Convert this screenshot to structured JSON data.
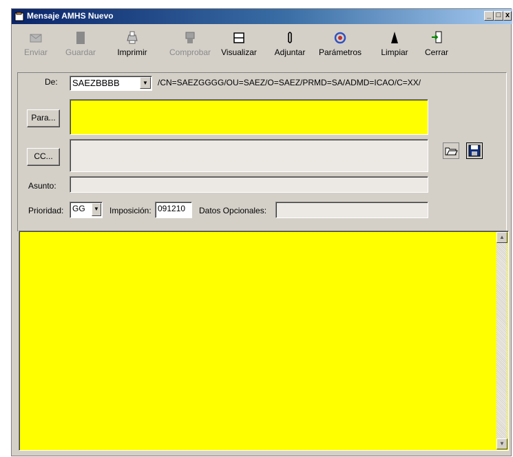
{
  "window": {
    "title": "Mensaje AMHS Nuevo",
    "controls": {
      "minimize": "_",
      "maximize": "□",
      "close": "x"
    }
  },
  "toolbar": {
    "buttons": [
      {
        "label": "Enviar",
        "icon": "send-icon",
        "enabled": false
      },
      {
        "label": "Guardar",
        "icon": "save-icon",
        "enabled": false
      },
      {
        "label": "Imprimir",
        "icon": "print-icon",
        "enabled": true
      },
      {
        "label": "Comprobar",
        "icon": "check-icon",
        "enabled": false
      },
      {
        "label": "Visualizar",
        "icon": "view-icon",
        "enabled": true
      },
      {
        "label": "Adjuntar",
        "icon": "paperclip-icon",
        "enabled": true
      },
      {
        "label": "Parámetros",
        "icon": "parameters-icon",
        "enabled": true
      },
      {
        "label": "Limpiar",
        "icon": "broom-icon",
        "enabled": true
      },
      {
        "label": "Cerrar",
        "icon": "exit-icon",
        "enabled": true
      }
    ]
  },
  "header": {
    "from_label": "De:",
    "from_value": "SAEZBBBB",
    "from_address": "/CN=SAEZGGGG/OU=SAEZ/O=SAEZ/PRMD=SA/ADMD=ICAO/C=XX/",
    "to_button": "Para...",
    "to_value": "",
    "cc_button": "CC...",
    "cc_value": "",
    "subject_label": "Asunto:",
    "subject_value": "",
    "priority_label": "Prioridad:",
    "priority_value": "GG",
    "filing_label": "Imposición:",
    "filing_value": "091210",
    "optional_label": "Datos Opcionales:",
    "optional_value": ""
  },
  "body": {
    "text": ""
  },
  "colors": {
    "highlight": "#ffff00",
    "titlebar_start": "#0a246a",
    "titlebar_end": "#a6caf0",
    "face": "#d4d0c8"
  }
}
